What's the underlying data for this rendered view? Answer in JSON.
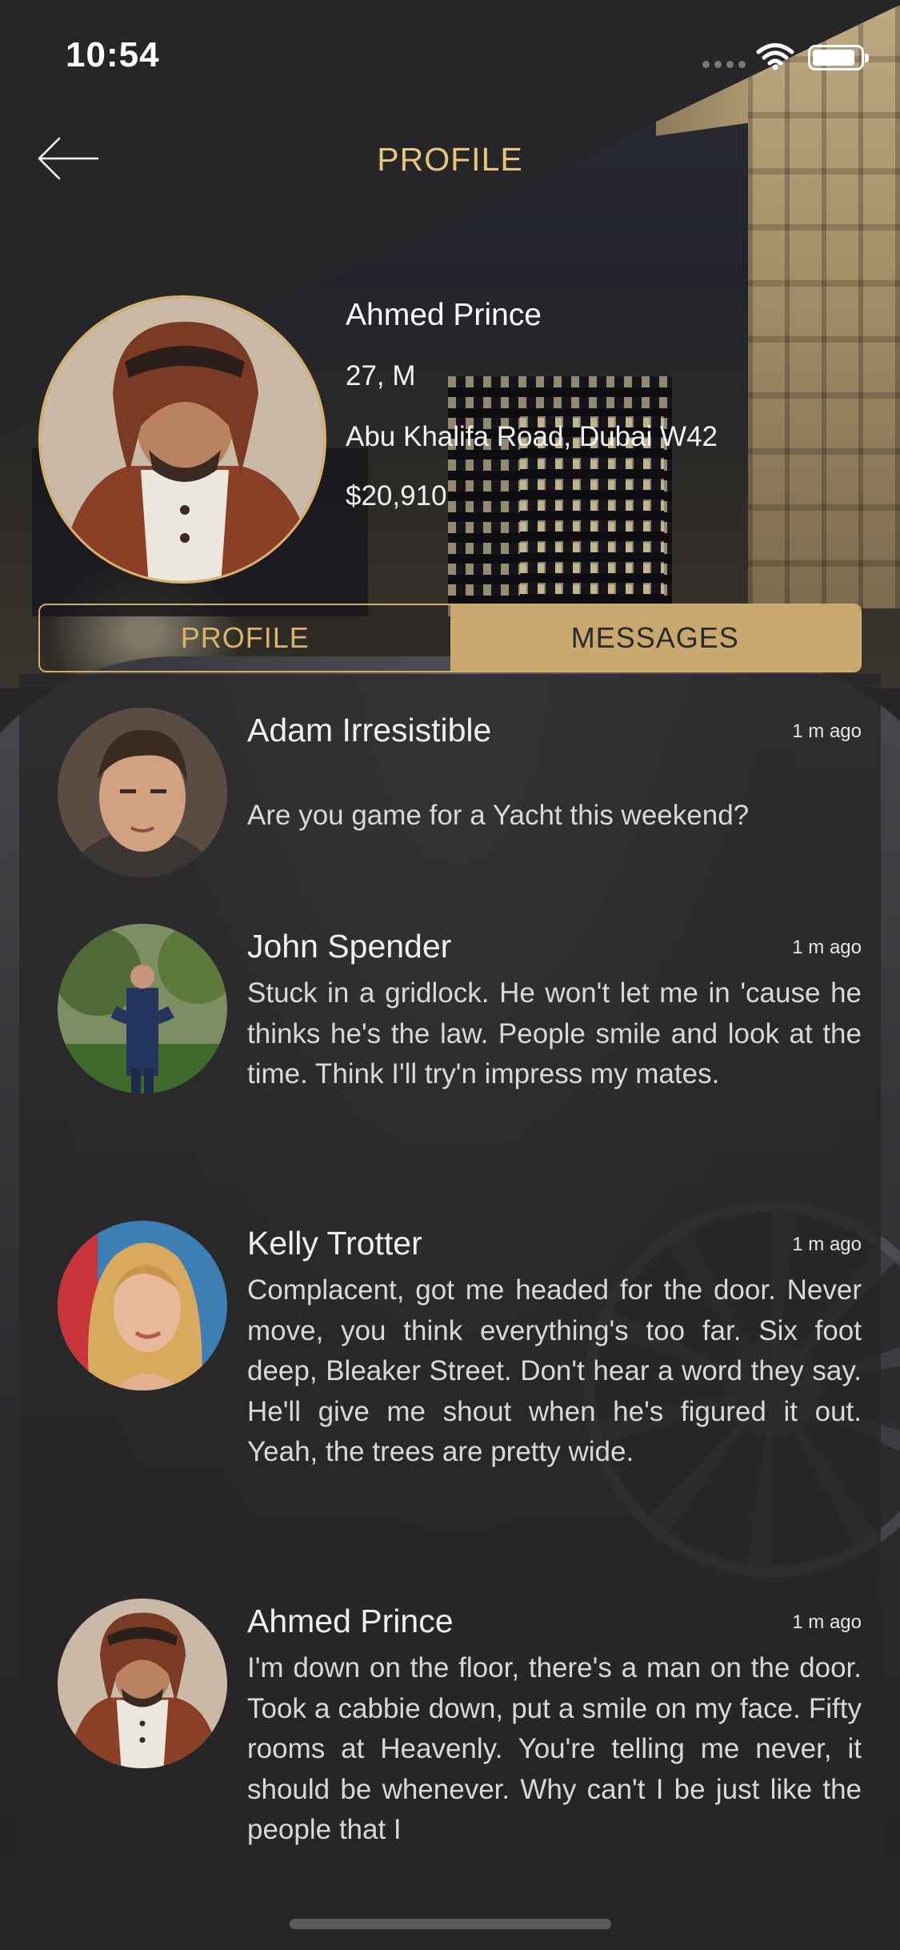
{
  "status_bar": {
    "time": "10:54"
  },
  "nav": {
    "title": "PROFILE",
    "back_icon": "arrow-left-icon"
  },
  "profile": {
    "name": "Ahmed Prince",
    "age_gender": "27, M",
    "address": "Abu Khalifa Road, Dubai W42",
    "amount": "$20,910"
  },
  "tabs": [
    {
      "label": "PROFILE",
      "active": false
    },
    {
      "label": "MESSAGES",
      "active": true
    }
  ],
  "messages": [
    {
      "name": "Adam Irresistible",
      "time": "1 m ago",
      "text": "Are you game for a Yacht this weekend?"
    },
    {
      "name": "John Spender",
      "time": "1 m ago",
      "text": "Stuck in a gridlock. He won't let me in 'cause he thinks he's the law. People smile and look at the time. Think I'll try'n impress my mates."
    },
    {
      "name": "Kelly Trotter",
      "time": "1 m ago",
      "text": "Complacent, got me headed for the door. Never move, you think everything's too far. Six foot deep, Bleaker Street. Don't hear a word they say. He'll give me shout when he's figured it out. Yeah, the trees are pretty wide."
    },
    {
      "name": "Ahmed Prince",
      "time": "1 m ago",
      "text": "I'm down on the floor, there's a man on the door. Took a cabbie down, put a smile on my face. Fifty rooms at Heavenly. You're telling me never, it should be whenever. Why can't I be just like the people that I"
    }
  ],
  "colors": {
    "accent": "#d9b46a",
    "tab_active_bg": "#c9a86f",
    "background": "#262628"
  }
}
